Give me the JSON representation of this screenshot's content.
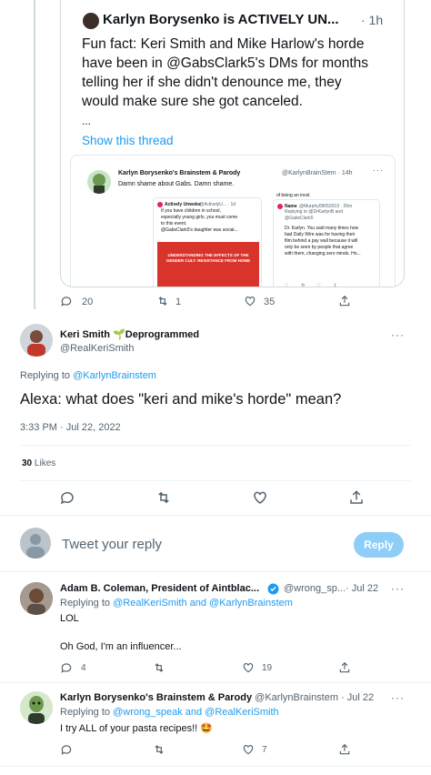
{
  "quoted_tweet": {
    "author": "Karlyn Borysenko is ACTIVELY UN...",
    "time": "· 1h",
    "text_lines": [
      "Fun fact: Keri Smith and Mike Harlow's horde",
      "have been in @GabsClark5's DMs for months",
      "telling her if she didn't denounce me, they",
      "would make sure she got canceled."
    ],
    "ellipsis": "...",
    "show_thread": "Show this thread",
    "nested": {
      "author": "Karlyn Borysenko's Brainstem & Parody",
      "handle_time": "@KarlynBrainStem · 14h",
      "text": "Damn shame about Gabs. Damn shame.",
      "left_author": "Actively Unwoke",
      "left_handle": "@ActivelyU... · 1d",
      "left_lines": [
        "If you have children in school,",
        "especially young girls, you must come",
        "to this event.",
        "",
        "@GabsClark5's daughter was social..."
      ],
      "red_title": "UNDERSTANDING THE EFFECTS OF THE GENDER CULT: RESISTANCE FROM HOME",
      "right_top": "of being an incel.",
      "right_author": "Name",
      "right_handle": "@Murphy09052019 · 26m",
      "right_reply": "Replying to @DrKarlynB and @GabsClark5",
      "right_lines": [
        "Dr. Karlyn. You said many times how",
        "bad Daily Wire was for having their",
        "film behind a pay wall because it will",
        "only be seen by people that agree",
        "with them, changing zero minds. Ho..."
      ]
    }
  },
  "top_actions": {
    "replies": "20",
    "retweets": "1",
    "likes": "35"
  },
  "main_tweet": {
    "name": "Keri Smith",
    "badge": "Deprogrammed",
    "handle": "@RealKeriSmith",
    "replying_label": "Replying to",
    "replying_to": "@KarlynBrainstem",
    "text": "Alexa: what does \"keri and mike's horde\" mean?",
    "timestamp": "3:33 PM · Jul 22, 2022",
    "likes_count": "30",
    "likes_label": "Likes"
  },
  "composer": {
    "placeholder": "Tweet your reply",
    "button": "Reply"
  },
  "reply1": {
    "name": "Adam B. Coleman, President of Aintblac...",
    "handle": "@wrong_sp...",
    "time": "· Jul 22",
    "replying_label": "Replying to",
    "replying_to": "@RealKeriSmith and @KarlynBrainstem",
    "line1": "LOL",
    "line2": "Oh God, I'm an influencer...",
    "replies": "4",
    "likes": "19"
  },
  "reply2": {
    "name": "Karlyn Borysenko's Brainstem & Parody",
    "handle_time": "@KarlynBrainstem · Jul 22",
    "replying_label": "Replying to",
    "replying_to": "@wrong_speak and @RealKeriSmith",
    "text": "I try ALL of your pasta recipes!!",
    "emoji": "🤩",
    "likes": "7"
  },
  "icons": [
    "reply-icon",
    "retweet-icon",
    "like-icon",
    "share-icon",
    "more-icon",
    "verified-icon",
    "seedling-icon"
  ],
  "colors": {
    "accent": "#1d9bf0",
    "text": "#0f1419",
    "secondary": "#536471",
    "border": "#cfd9de",
    "reply_button_disabled": "#8ecdf8"
  }
}
